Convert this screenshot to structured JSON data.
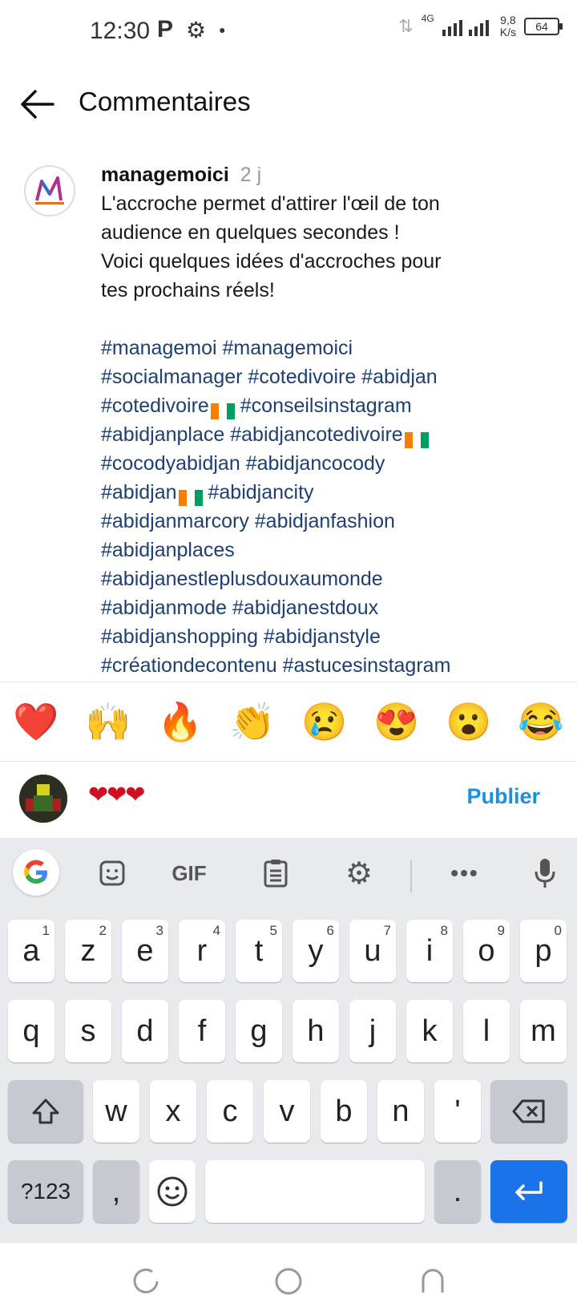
{
  "status_bar": {
    "time": "12:30",
    "left_icons": [
      "parking-icon",
      "gear-icon",
      "dot-icon"
    ],
    "network": "4G",
    "speed_value": "9,8",
    "speed_unit": "K/s",
    "battery": "64"
  },
  "header": {
    "title": "Commentaires"
  },
  "comment": {
    "username": "managemoici",
    "time": "2 j",
    "caption_lines": [
      "L'accroche permet d'attirer l'œil de ton",
      "audience en quelques secondes !",
      "Voici quelques idées d'accroches pour",
      "tes prochains réels!"
    ],
    "hashtag_lines": [
      "#managemoi #managemoici",
      "#socialmanager #cotedivoire #abidjan",
      "#cotedivoire",
      " #conseilsinstagram",
      "#abidjanplace #abidjancotedivoire",
      "#cocodyabidjan #abidjancocody",
      "#abidjan",
      " #abidjancity",
      "#abidjanmarcory #abidjanfashion",
      "#abidjanplaces",
      "#abidjanestleplusdouxaumonde",
      "#abidjanmode #abidjanestdoux",
      "#abidjanshopping #abidjanstyle",
      "#créationdecontenu #astucesinstagram"
    ],
    "flag_colors": [
      "#f77f00",
      "#ffffff",
      "#009e60"
    ]
  },
  "emoji_bar": [
    "❤️",
    "🙌",
    "🔥",
    "👏",
    "😢",
    "😍",
    "😮",
    "😂"
  ],
  "compose": {
    "input_value": "❤❤❤",
    "publish_label": "Publier"
  },
  "keyboard": {
    "toolbar": [
      "google-icon",
      "sticker-icon",
      "GIF",
      "clipboard-icon",
      "gear-icon",
      "more-icon",
      "mic-icon"
    ],
    "gif_label": "GIF",
    "row1": [
      "a",
      "z",
      "e",
      "r",
      "t",
      "y",
      "u",
      "i",
      "o",
      "p"
    ],
    "row1_hints": [
      "1",
      "2",
      "3",
      "4",
      "5",
      "6",
      "7",
      "8",
      "9",
      "0"
    ],
    "row2": [
      "q",
      "s",
      "d",
      "f",
      "g",
      "h",
      "j",
      "k",
      "l",
      "m"
    ],
    "row3": [
      "w",
      "x",
      "c",
      "v",
      "b",
      "n",
      "'"
    ],
    "symbols_label": "?123",
    "comma": ",",
    "period": ".",
    "accent_color": "#1a73e8"
  },
  "nav_bar": [
    "recents-icon",
    "home-icon",
    "back-icon"
  ]
}
